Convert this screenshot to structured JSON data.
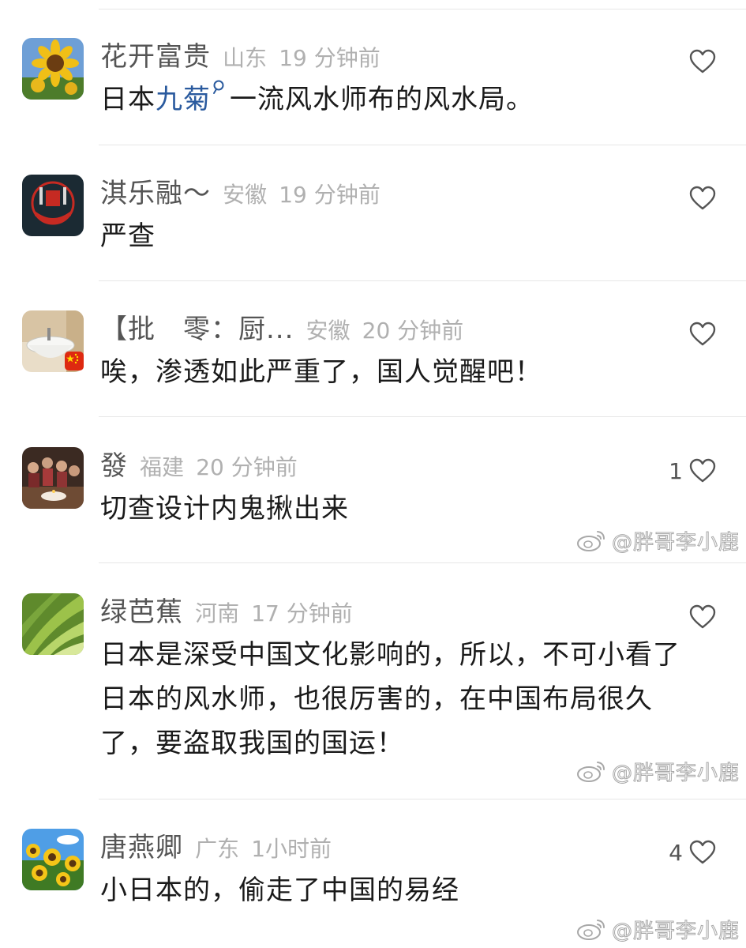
{
  "colors": {
    "username": "#555555",
    "meta": "#b0b0b0",
    "text": "#1a1a1a",
    "link": "#2a5a9e",
    "divider": "#e6e6e6"
  },
  "comments": [
    {
      "username": "花开富贵",
      "location": "山东",
      "time": "19 分钟前",
      "text_before": "日本",
      "keyword": "九菊",
      "text_after": "一流风水师布的风水局。",
      "likes": "",
      "avatar_icon": "sunflower-avatar-icon"
    },
    {
      "username": "淇乐融～",
      "location": "安徽",
      "time": "19 分钟前",
      "text": "严查",
      "likes": "",
      "avatar_icon": "red-seal-avatar-icon"
    },
    {
      "username": "【批　零：厨...",
      "location": "安徽",
      "time": "20 分钟前",
      "text": "唉，渗透如此严重了，国人觉醒吧！",
      "likes": "",
      "avatar_icon": "sink-avatar-icon",
      "badge_icon": "china-flag-icon"
    },
    {
      "username": "發",
      "location": "福建",
      "time": "20 分钟前",
      "text": "切查设计内鬼揪出来",
      "likes": "1",
      "avatar_icon": "family-dinner-avatar-icon"
    },
    {
      "username": "绿芭蕉",
      "location": "河南",
      "time": "17 分钟前",
      "text": "日本是深受中国文化影响的，所以，不可小看了日本的风水师，也很厉害的，在中国布局很久了，要盗取我国的国运！",
      "likes": "",
      "avatar_icon": "banana-leaf-avatar-icon"
    },
    {
      "username": "唐燕卿",
      "location": "广东",
      "time": "1小时前",
      "text": "小日本的，偷走了中国的易经",
      "likes": "4",
      "avatar_icon": "sunflower-field-avatar-icon"
    }
  ],
  "watermark": {
    "text": "@胖哥李小鹿",
    "icon": "weibo-logo-icon"
  }
}
